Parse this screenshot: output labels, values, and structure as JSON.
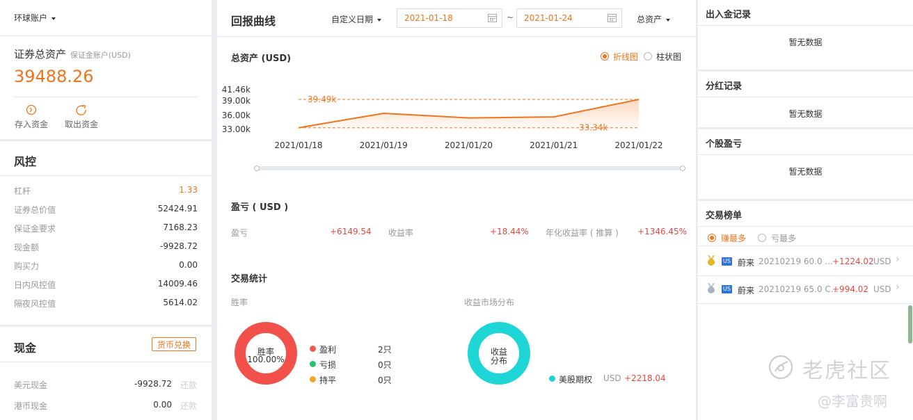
{
  "left": {
    "account_selector": "环球账户",
    "total_assets_label": "证券总资产",
    "account_type": "保证金账户(USD)",
    "total_assets_value": "39488.26",
    "deposit_label": "存入资金",
    "withdraw_label": "取出资金",
    "risk_title": "风控",
    "risk_rows": [
      {
        "label": "杠杆",
        "value": "1.33"
      },
      {
        "label": "证券总价值",
        "value": "52424.91"
      },
      {
        "label": "保证金要求",
        "value": "7168.23"
      },
      {
        "label": "现金额",
        "value": "-9928.72"
      },
      {
        "label": "购买力",
        "value": "0.00"
      },
      {
        "label": "日内风控值",
        "value": "14009.46"
      },
      {
        "label": "隔夜风控值",
        "value": "5614.02"
      }
    ],
    "cash_title": "现金",
    "currency_exchange_button": "货币兑换",
    "cash_rows": [
      {
        "label": "美元现金",
        "value": "-9928.72",
        "action": "还款"
      },
      {
        "label": "港币现金",
        "value": "0.00",
        "action": "还款"
      }
    ]
  },
  "middle": {
    "title": "回报曲线",
    "date_mode": "自定义日期",
    "start_date": "2021-01-18",
    "date_separator": "~",
    "end_date": "2021-01-24",
    "asset_selector": "总资产",
    "chart_title": "总资产 (USD)",
    "chart_type_options": [
      {
        "label": "折线图",
        "selected": true
      },
      {
        "label": "柱状图",
        "selected": false
      }
    ],
    "pnl_title": "盈亏 ( USD )",
    "pnl_items": [
      {
        "label": "盈亏",
        "value": "+6149.54"
      },
      {
        "label": "收益率",
        "value": "+18.44%"
      },
      {
        "label": "年化收益率 ( 推算 )",
        "value": "+1346.45%"
      }
    ],
    "trade_stats_title": "交易统计",
    "win_rate_label": "胜率",
    "win_rate_center_label": "胜率",
    "win_rate_center_value": "100.00%",
    "win_legend": [
      {
        "label": "盈利",
        "count": "2只",
        "color": "#f15a54"
      },
      {
        "label": "亏损",
        "count": "0只",
        "color": "#27c36a"
      },
      {
        "label": "持平",
        "count": "0只",
        "color": "#f5a623"
      }
    ],
    "market_dist_label": "收益市场分布",
    "market_center_line1": "收益",
    "market_center_line2": "分布",
    "market_legend": [
      {
        "label": "美股期权",
        "currency": "USD",
        "value": "+2218.04",
        "color": "#1ed6d6"
      }
    ]
  },
  "chart_data": {
    "type": "area",
    "title": "总资产 (USD)",
    "x": [
      "2021/01/18",
      "2021/01/19",
      "2021/01/20",
      "2021/01/21",
      "2021/01/22"
    ],
    "values": [
      33340,
      36480,
      35480,
      35700,
      39490
    ],
    "yticks": [
      "41.46k",
      "39.00k",
      "36.00k",
      "33.00k"
    ],
    "ylim": [
      33000,
      41460
    ],
    "max_label": "39.49k",
    "min_label": "33.34k",
    "line_color": "#f0741c",
    "grid": false
  },
  "right": {
    "deposit_records_title": "出入金记录",
    "deposit_records_empty": "暂无数据",
    "dividend_records_title": "分红记录",
    "dividend_records_empty": "暂无数据",
    "stock_pnl_title": "个股盈亏",
    "stock_pnl_empty": "暂无数据",
    "ranking_title": "交易榜单",
    "ranking_tabs": [
      {
        "label": "赚最多",
        "selected": true
      },
      {
        "label": "亏最多",
        "selected": false
      }
    ],
    "ranking_rows": [
      {
        "market": "US",
        "name": "蔚来",
        "contract": "20210219 60.0 ...",
        "value": "+1224.02",
        "currency": "USD",
        "medal": "gold"
      },
      {
        "market": "US",
        "name": "蔚来",
        "contract": "20210219 65.0 C...",
        "value": "+994.02",
        "currency": "USD",
        "medal": "silver"
      }
    ]
  },
  "watermark": {
    "brand": "老虎社区",
    "author": "@李富贵啊"
  }
}
